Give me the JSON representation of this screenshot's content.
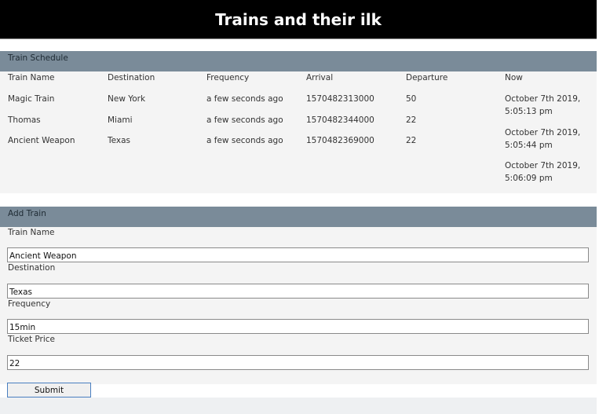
{
  "header": {
    "title": "Trains and their ilk"
  },
  "schedule": {
    "heading": "Train Schedule",
    "columns": [
      "Train Name",
      "Destination",
      "Frequency",
      "Arrival",
      "Departure",
      "Now"
    ],
    "rows": [
      {
        "name": "Magic Train",
        "destination": "New York",
        "frequency": "a few seconds ago",
        "arrival": "1570482313000",
        "departure": "50"
      },
      {
        "name": "Thomas",
        "destination": "Miami",
        "frequency": "a few seconds ago",
        "arrival": "1570482344000",
        "departure": "22"
      },
      {
        "name": "Ancient Weapon",
        "destination": "Texas",
        "frequency": "a few seconds ago",
        "arrival": "1570482369000",
        "departure": "22"
      }
    ],
    "now": [
      {
        "line1": "October 7th 2019,",
        "line2": "5:05:13 pm"
      },
      {
        "line1": "October 7th 2019,",
        "line2": "5:05:44 pm"
      },
      {
        "line1": "October 7th 2019,",
        "line2": "5:06:09 pm"
      }
    ]
  },
  "form": {
    "heading": "Add Train",
    "fields": [
      {
        "label": "Train Name",
        "value": "Ancient Weapon"
      },
      {
        "label": "Destination",
        "value": "Texas"
      },
      {
        "label": "Frequency",
        "value": "15min"
      },
      {
        "label": "Ticket Price",
        "value": "22"
      }
    ],
    "submit_label": "Submit"
  },
  "colors": {
    "header_bg": "#000000",
    "panel_heading_bg": "#7a8b99",
    "panel_body_bg": "#f4f4f4",
    "button_border": "#4a7fc0"
  }
}
